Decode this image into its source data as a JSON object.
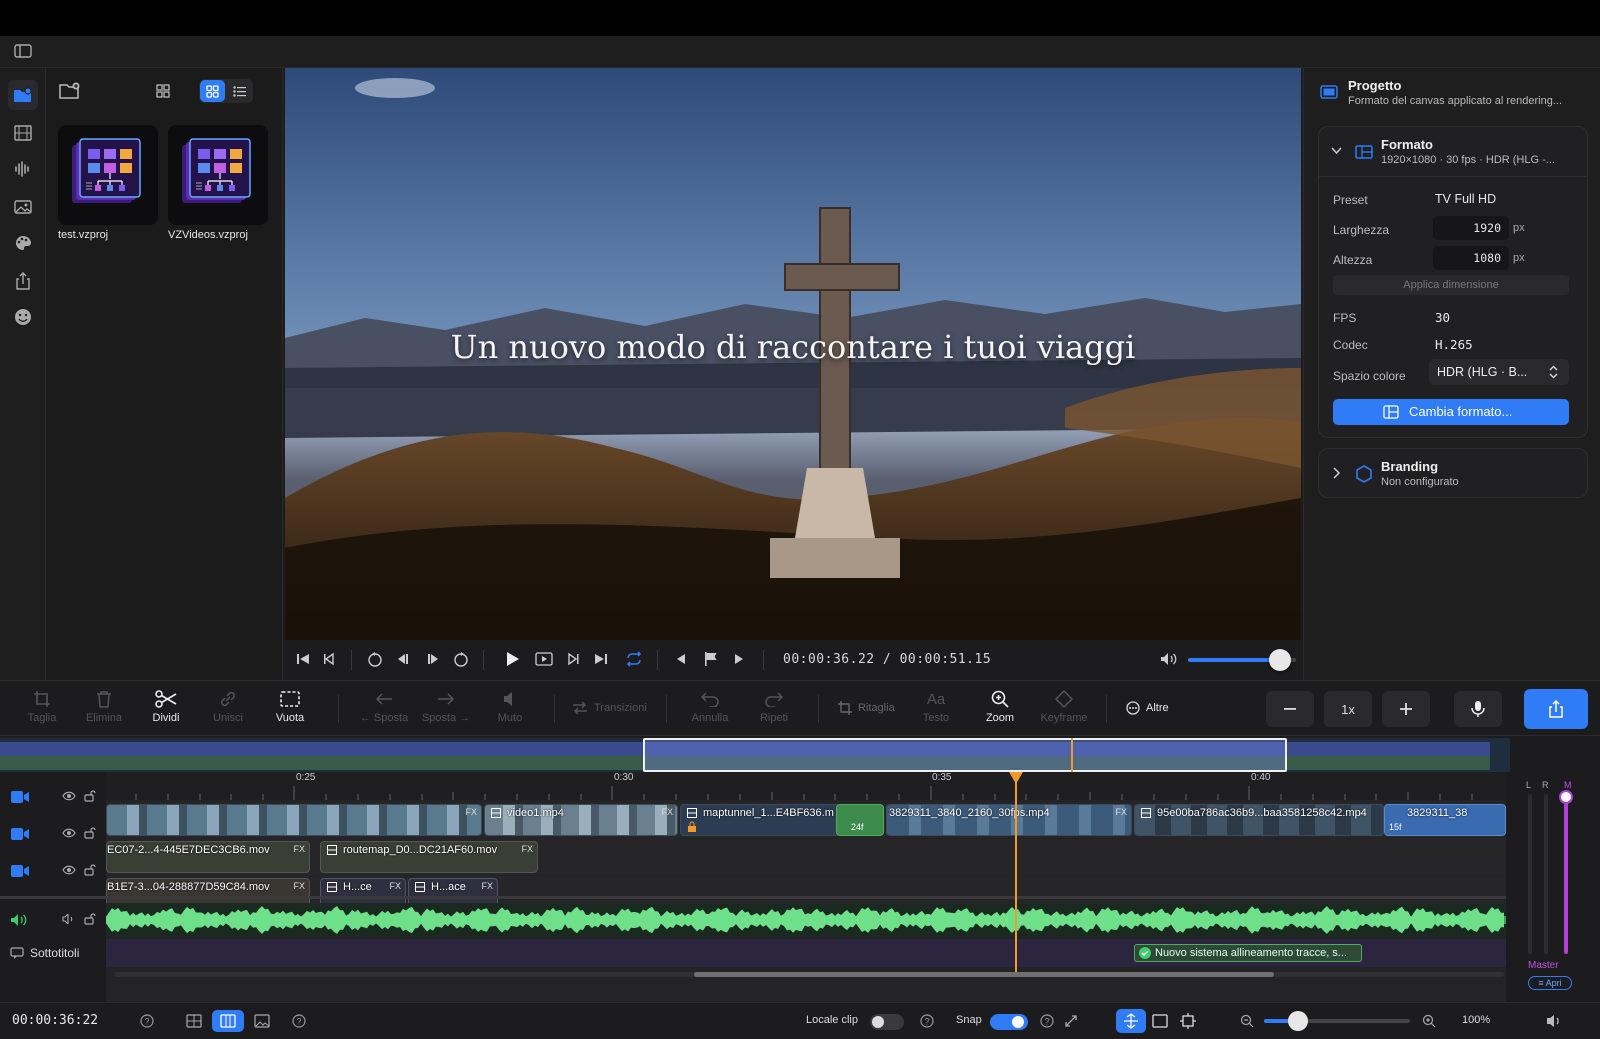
{
  "app": {
    "accent": "#2f7cf6"
  },
  "rail": {
    "icons": [
      "folder-add-icon",
      "film-icon",
      "waveform-icon",
      "image-icon",
      "palette-icon",
      "share-icon",
      "emoji-icon"
    ]
  },
  "media": {
    "items": [
      {
        "name": "test.vzproj"
      },
      {
        "name": "VZVideos.vzproj"
      }
    ]
  },
  "preview": {
    "overlay_text": "Un nuovo modo di raccontare i tuoi viaggi"
  },
  "transport": {
    "timecode": "00:00:36.22 / 00:00:51.15",
    "volume": 0.85
  },
  "inspector": {
    "project_title": "Progetto",
    "project_subtitle": "Formato del canvas applicato al rendering...",
    "format_title": "Formato",
    "format_subtitle": "1920×1080 · 30 fps · HDR (HLG -...",
    "preset_label": "Preset",
    "preset_value": "TV Full HD",
    "width_label": "Larghezza",
    "width_value": "1920",
    "height_label": "Altezza",
    "height_value": "1080",
    "unit": "px",
    "apply_label": "Applica dimensione",
    "fps_label": "FPS",
    "fps_value": "30",
    "codec_label": "Codec",
    "codec_value": "H.265",
    "colorspace_label": "Spazio colore",
    "colorspace_value": "HDR (HLG · B...",
    "change_format_label": "Cambia formato...",
    "branding_title": "Branding",
    "branding_subtitle": "Non configurato"
  },
  "toolbar": {
    "taglia": "Taglia",
    "elimina": "Elimina",
    "dividi": "Dividi",
    "unisci": "Unisci",
    "vuota": "Vuota",
    "sposta_left": "← Sposta",
    "sposta_right": "Sposta →",
    "muto": "Muto",
    "transizioni": "Transizioni",
    "annulla": "Annulla",
    "ripeti": "Ripeti",
    "ritaglia": "Ritaglia",
    "testo": "Testo",
    "zoom": "Zoom",
    "keyframe": "Keyframe",
    "altre": "Altre",
    "speed": "1x"
  },
  "timeline": {
    "ruler": [
      "0:25",
      "0:30",
      "0:35",
      "0:40"
    ],
    "video1": [
      {
        "name": "",
        "fx": "FX"
      },
      {
        "name": "video1.mp4",
        "fx": "FX"
      },
      {
        "name": "maptunnel_1...E4BF636.m",
        "fx": ""
      },
      {
        "name": "3829311_3840_2160_30fps.mp4",
        "fx": "FX"
      },
      {
        "name": "95e00ba786ac36b9...baa3581258c42.mp4",
        "fx": ""
      },
      {
        "name": "3829311_38",
        "fx": ""
      }
    ],
    "video2": [
      {
        "name": "EC07-2...4-445E7DEC3CB6.mov",
        "fx": "FX"
      },
      {
        "name": "routemap_D0...DC21AF60.mov",
        "fx": "FX"
      }
    ],
    "video3": [
      {
        "name": "B1E7-3...04-288877D59C84.mov",
        "fx": "FX"
      },
      {
        "name": "H...ce",
        "fx": "FX"
      },
      {
        "name": "H...ace",
        "fx": "FX"
      }
    ],
    "frame_badges": [
      "24f",
      "15f"
    ],
    "subtitles_label": "Sottotitoli",
    "subtitle_text": "Nuovo sistema allineamento tracce, s..."
  },
  "mixer": {
    "l": "L",
    "r": "R",
    "m": "M",
    "master": "Master",
    "open": "Apri"
  },
  "bottom": {
    "timecode": "00:00:36:22",
    "locale_clip": "Locale clip",
    "snap": "Snap",
    "zoom_pct": "100%"
  }
}
